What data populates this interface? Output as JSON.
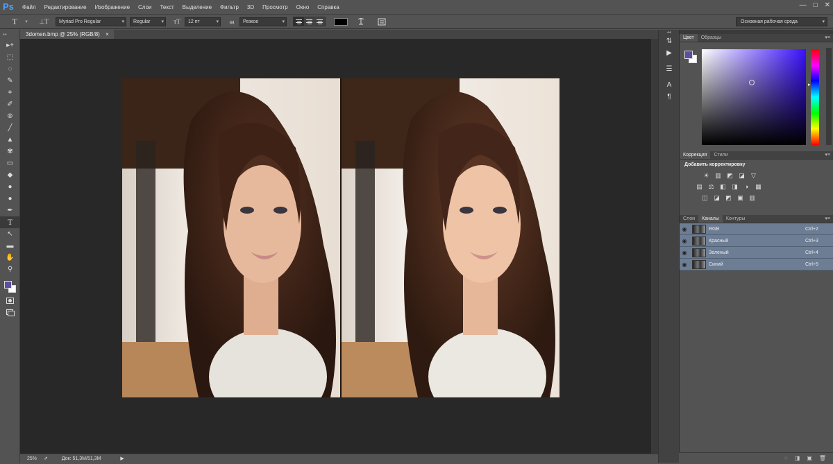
{
  "app": {
    "logo": "Ps"
  },
  "menu": [
    "Файл",
    "Редактирование",
    "Изображение",
    "Слои",
    "Текст",
    "Выделение",
    "Фильтр",
    "3D",
    "Просмотр",
    "Окно",
    "Справка"
  ],
  "window_controls": {
    "minimize": "—",
    "maximize": "□",
    "close": "✕"
  },
  "options": {
    "tool_icon": "T",
    "orient_icon": "⊥T",
    "font_family": "Myriad Pro Regular",
    "font_style": "Regular",
    "size_icon": "тT",
    "font_size": "12 пт",
    "aa_icon": "aa",
    "antialias": "Резкое",
    "workspace": "Основная рабочая среда"
  },
  "document": {
    "tab_title": "3domen.bmp @ 25% (RGB/8)",
    "close": "×",
    "zoom": "25%",
    "doc_size": "Док: 51,3M/51,3M",
    "arrow": "▶"
  },
  "tools": [
    "▸+",
    "⬚",
    "◌",
    "✎",
    "⌗",
    "✐",
    "⊚",
    "╱",
    "▲",
    "✾",
    "▭",
    "◆",
    "●",
    "✒",
    "T",
    "↖",
    "▬",
    "✋",
    "⚲"
  ],
  "strip_icons": [
    "⇅",
    "▶",
    "☰",
    "A",
    "¶"
  ],
  "color_panel": {
    "tabs": [
      "Цвет",
      "Образцы"
    ],
    "menu": "▾≡"
  },
  "adjust_panel": {
    "tabs": [
      "Коррекция",
      "Стили"
    ],
    "title": "Добавить корректировку",
    "row1": [
      "☀",
      "▥",
      "◩",
      "◪",
      "▽"
    ],
    "row2": [
      "▤",
      "⚖",
      "◧",
      "◨",
      "◑",
      "▦"
    ],
    "row3": [
      "◫",
      "◪",
      "◩",
      "▣",
      "▥"
    ]
  },
  "channels_panel": {
    "tabs": [
      "Слои",
      "Каналы",
      "Контуры"
    ],
    "eye_icon": "◉",
    "channels": [
      {
        "name": "RGB",
        "key": "Ctrl+2"
      },
      {
        "name": "Красный",
        "key": "Ctrl+3"
      },
      {
        "name": "Зеленый",
        "key": "Ctrl+4"
      },
      {
        "name": "Синий",
        "key": "Ctrl+5"
      }
    ],
    "footer_icons": [
      "◌",
      "◨",
      "▣",
      "🗑"
    ]
  }
}
